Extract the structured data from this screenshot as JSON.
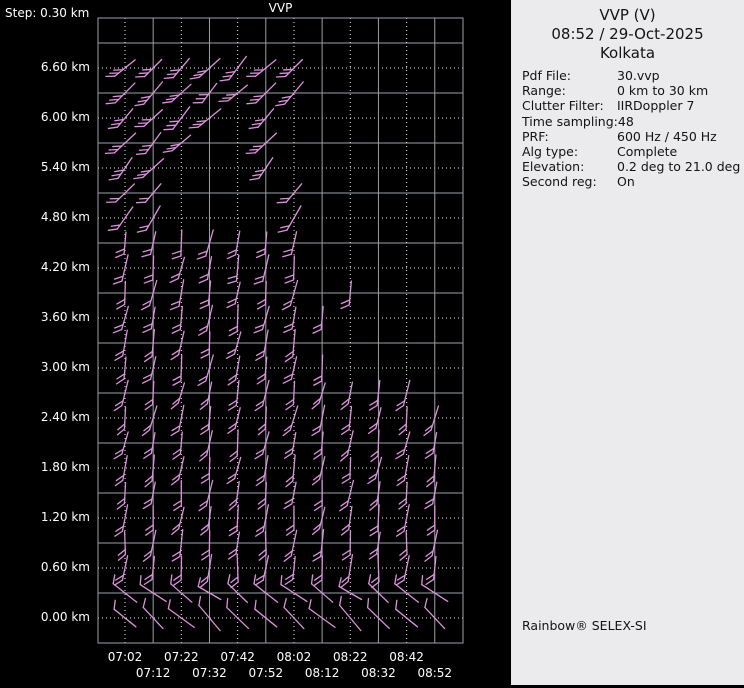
{
  "left_chart": {
    "step_label": "Step: 0.30 km",
    "title": "VVP",
    "y_axis_labels": [
      "6.60 km",
      "6.00 km",
      "5.40 km",
      "4.80 km",
      "4.20 km",
      "3.60 km",
      "3.00 km",
      "2.40 km",
      "1.80 km",
      "1.20 km",
      "0.60 km",
      "0.00 km"
    ],
    "x_axis_row1": [
      "07:02",
      "07:22",
      "07:42",
      "08:02",
      "08:22",
      "08:42"
    ],
    "x_axis_row2": [
      "07:12",
      "07:32",
      "07:52",
      "08:12",
      "08:32",
      "08:52"
    ]
  },
  "info_panel": {
    "title": "VVP (V)",
    "datetime": "08:52 / 29-Oct-2025",
    "site": "Kolkata",
    "fields": [
      {
        "label": "Pdf File:",
        "value": "30.vvp"
      },
      {
        "label": "Range:",
        "value": "0 km to 30 km"
      },
      {
        "label": "Clutter Filter:",
        "value": "IIRDoppler 7"
      },
      {
        "label": "Time sampling:",
        "value": "48"
      },
      {
        "label": "PRF:",
        "value": "600 Hz / 450 Hz"
      },
      {
        "label": "Alg type:",
        "value": "Complete"
      },
      {
        "label": "Elevation:",
        "value": "0.2 deg to 21.0 deg"
      },
      {
        "label": "Second reg:",
        "value": "On"
      }
    ],
    "footer": "Rainbow® SELEX-SI"
  },
  "colors": {
    "background": "#000000",
    "barb": "#DC92DC",
    "grid_solid": "#9AA0A8",
    "grid_dotted": "#EFEFEF",
    "axis_text": "#FFFFFF",
    "panel_bg": "#EBEBED",
    "panel_text": "#131313"
  },
  "chart_data": {
    "type": "wind-barb-time-height-profile",
    "title": "VVP",
    "x_times": [
      "07:02",
      "07:12",
      "07:22",
      "07:32",
      "07:42",
      "07:52",
      "08:02",
      "08:12",
      "08:22",
      "08:32",
      "08:42",
      "08:52"
    ],
    "x_step_minutes": 10,
    "y_km_labeled": [
      6.6,
      6.0,
      5.4,
      4.8,
      4.2,
      3.6,
      3.0,
      2.4,
      1.8,
      1.2,
      0.6,
      0.0
    ],
    "y_step_km": 0.3,
    "barb_rows": [
      {
        "alt": 6.6,
        "cols": [
          0,
          1,
          2,
          3,
          4,
          5,
          6
        ],
        "angle": 45,
        "feathers": 3,
        "len": 26,
        "fa": 185
      },
      {
        "alt": 6.3,
        "cols": [
          0,
          1,
          2,
          3,
          4,
          5,
          6
        ],
        "angle": 45,
        "feathers": 3,
        "len": 26,
        "fa": 185
      },
      {
        "alt": 6.0,
        "cols": [
          0,
          1,
          2,
          3,
          5
        ],
        "angle": 45,
        "feathers": 3,
        "len": 26,
        "fa": 185
      },
      {
        "alt": 5.7,
        "cols": [
          0,
          1,
          2,
          5
        ],
        "angle": 46,
        "feathers": 3,
        "len": 26,
        "fa": 185
      },
      {
        "alt": 5.4,
        "cols": [
          0,
          1,
          5
        ],
        "angle": 48,
        "feathers": 3,
        "len": 26,
        "fa": 185
      },
      {
        "alt": 5.1,
        "cols": [
          0,
          1,
          6
        ],
        "angle": 50,
        "feathers": 2,
        "len": 26,
        "fa": 185
      },
      {
        "alt": 4.8,
        "cols": [
          0,
          1,
          6
        ],
        "angle": 55,
        "feathers": 2,
        "len": 25,
        "fa": 188
      },
      {
        "alt": 4.5,
        "cols": [
          0,
          1,
          2,
          3,
          4,
          5,
          6
        ],
        "angle": 80,
        "feathers": 2,
        "len": 24,
        "fa": 200
      },
      {
        "alt": 4.2,
        "cols": [
          0,
          1,
          2,
          3,
          4,
          5,
          6
        ],
        "angle": 80,
        "feathers": 2,
        "len": 24,
        "fa": 200
      },
      {
        "alt": 3.9,
        "cols": [
          0,
          1,
          2,
          3,
          4,
          5,
          6,
          8
        ],
        "angle": 80,
        "feathers": 2,
        "len": 24,
        "fa": 205
      },
      {
        "alt": 3.6,
        "cols": [
          0,
          1,
          2,
          3,
          4,
          5,
          6,
          7
        ],
        "angle": 80,
        "feathers": 2,
        "len": 24,
        "fa": 205
      },
      {
        "alt": 3.3,
        "cols": [
          0,
          1,
          2,
          3,
          4,
          5,
          6
        ],
        "angle": 80,
        "feathers": 2,
        "len": 24,
        "fa": 210
      },
      {
        "alt": 3.0,
        "cols": [
          0,
          1,
          2,
          3,
          4,
          5,
          6,
          7
        ],
        "angle": 80,
        "feathers": 2,
        "len": 24,
        "fa": 210
      },
      {
        "alt": 2.7,
        "cols": [
          0,
          1,
          2,
          3,
          4,
          5,
          6,
          7,
          8,
          9,
          10
        ],
        "angle": 79,
        "feathers": 2,
        "len": 23,
        "fa": 215
      },
      {
        "alt": 2.4,
        "cols": [
          0,
          1,
          2,
          3,
          4,
          5,
          6,
          7,
          8,
          9,
          10,
          11
        ],
        "angle": 79,
        "feathers": 2,
        "len": 23,
        "fa": 215
      },
      {
        "alt": 2.1,
        "cols": [
          0,
          1,
          2,
          3,
          4,
          5,
          6,
          7,
          8,
          9,
          10,
          11
        ],
        "angle": 80,
        "feathers": 2,
        "len": 23,
        "fa": 215
      },
      {
        "alt": 1.8,
        "cols": [
          0,
          1,
          2,
          3,
          4,
          5,
          6,
          7,
          8,
          9,
          10,
          11
        ],
        "angle": 80,
        "feathers": 2,
        "len": 23,
        "fa": 215
      },
      {
        "alt": 1.5,
        "cols": [
          0,
          1,
          2,
          3,
          4,
          5,
          6,
          7,
          8,
          9,
          10,
          11
        ],
        "angle": 82,
        "feathers": 2,
        "len": 23,
        "fa": 215
      },
      {
        "alt": 1.2,
        "cols": [
          0,
          1,
          2,
          3,
          4,
          5,
          6,
          7,
          8,
          9,
          10,
          11
        ],
        "angle": 82,
        "feathers": 2,
        "len": 24,
        "fa": 215
      },
      {
        "alt": 0.9,
        "cols": [
          0,
          1,
          2,
          3,
          4,
          5,
          6,
          7,
          8,
          9,
          10,
          11
        ],
        "angle": 84,
        "feathers": 2,
        "len": 24,
        "fa": 215
      },
      {
        "alt": 0.6,
        "cols": [
          0,
          1,
          2,
          3,
          4,
          5,
          6,
          7,
          8,
          9,
          10,
          11
        ],
        "angle": 84,
        "feathers": 2,
        "len": 25,
        "fa": 215
      },
      {
        "alt": 0.3,
        "cols": [
          0,
          1,
          2,
          3,
          4,
          5,
          6,
          7,
          8,
          9,
          10,
          11
        ],
        "angle": -38,
        "feathers": 1,
        "len": 28,
        "fa": 80
      },
      {
        "alt": 0.0,
        "cols": [
          0,
          1,
          2,
          3,
          4,
          5,
          6,
          7,
          8,
          9,
          10,
          11
        ],
        "angle": -44,
        "feathers": 1,
        "len": 30,
        "fa": 80
      }
    ]
  }
}
